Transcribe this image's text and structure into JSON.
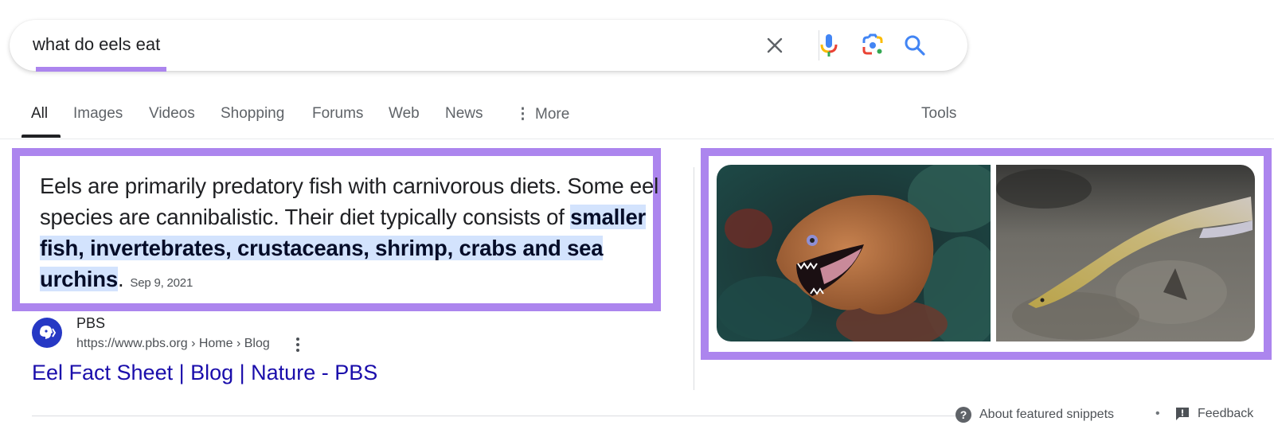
{
  "search": {
    "query": "what do eels eat",
    "icons": [
      "clear-icon",
      "microphone-icon",
      "google-lens-icon",
      "search-icon"
    ]
  },
  "tabs": [
    {
      "label": "All",
      "active": true
    },
    {
      "label": "Images"
    },
    {
      "label": "Videos"
    },
    {
      "label": "Shopping"
    },
    {
      "label": "Forums"
    },
    {
      "label": "Web"
    },
    {
      "label": "News"
    },
    {
      "label": "More",
      "icon": "vertical-dots-icon"
    },
    {
      "label": "Tools"
    }
  ],
  "snippet": {
    "text_plain": "Eels are primarily predatory fish with carnivorous diets. Some eel species are cannibalistic. Their diet typically consists of ",
    "text_highlight": "smaller fish, invertebrates, crustaceans, shrimp, crabs and sea urchins",
    "text_end": ".",
    "date": "Sep 9, 2021"
  },
  "source": {
    "name": "PBS",
    "url": "https://www.pbs.org › Home › Blog",
    "title": "Eel Fact Sheet | Blog | Nature - PBS"
  },
  "images": [
    {
      "alt": "moray-eel-photo"
    },
    {
      "alt": "freshwater-eel-photo"
    }
  ],
  "footer": {
    "about": "About featured snippets",
    "separator": "•",
    "feedback": "Feedback"
  },
  "colors": {
    "highlight_border": "#ac85ee",
    "link": "#1a0dab",
    "snippet_highlight_bg": "#d3e3fd"
  }
}
